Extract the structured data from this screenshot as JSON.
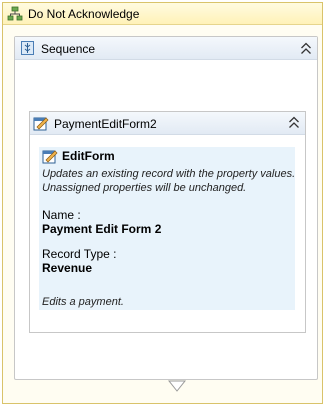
{
  "outer": {
    "title": "Do Not Acknowledge",
    "icon": "flowchart-icon"
  },
  "sequence": {
    "title": "Sequence",
    "icon": "sequence-icon"
  },
  "activity": {
    "title": "PaymentEditForm2",
    "icon": "edit-form-icon",
    "type_title": "EditForm",
    "description": "Updates an existing record with the property values. Unassigned properties will be unchanged.",
    "name_label": "Name :",
    "name_value": "Payment Edit Form 2",
    "record_type_label": "Record Type :",
    "record_type_value": "Revenue",
    "footer": "Edits a payment."
  }
}
